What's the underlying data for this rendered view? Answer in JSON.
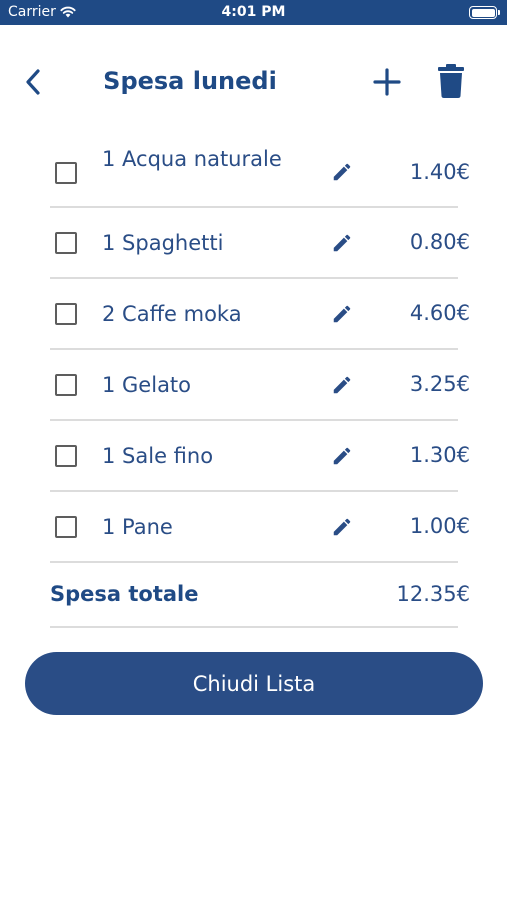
{
  "status_bar": {
    "carrier": "Carrier",
    "time": "4:01 PM"
  },
  "nav": {
    "title": "Spesa lunedi"
  },
  "items": [
    {
      "name": "1 Acqua naturale",
      "price": "1.40€"
    },
    {
      "name": "1 Spaghetti",
      "price": "0.80€"
    },
    {
      "name": "2 Caffe moka",
      "price": "4.60€"
    },
    {
      "name": "1 Gelato",
      "price": "3.25€"
    },
    {
      "name": "1 Sale fino",
      "price": "1.30€"
    },
    {
      "name": "1 Pane",
      "price": "1.00€"
    }
  ],
  "total": {
    "label": "Spesa totale",
    "value": "12.35€"
  },
  "close_button": {
    "label": "Chiudi Lista"
  },
  "colors": {
    "primary": "#2a4d86",
    "status_bar": "#1f4a85",
    "divider": "#dcdcdc"
  }
}
